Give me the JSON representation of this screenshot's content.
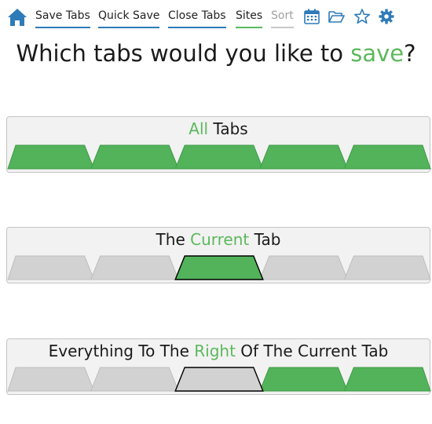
{
  "nav": {
    "home_icon": "home-icon",
    "links": [
      {
        "label": "Save Tabs",
        "state": "active"
      },
      {
        "label": "Quick Save",
        "state": "active"
      },
      {
        "label": "Close Tabs",
        "state": "active"
      },
      {
        "label": "Sites",
        "state": "highlight"
      },
      {
        "label": "Sort",
        "state": "disabled"
      }
    ],
    "icons": [
      "calendar-icon",
      "folder-open-icon",
      "star-icon",
      "gear-icon"
    ]
  },
  "heading": {
    "before": "Which tabs would you like to ",
    "accent": "save",
    "after": "?"
  },
  "options": [
    {
      "title_before": "",
      "title_accent": "All",
      "title_after": " Tabs",
      "tabs": [
        "selected",
        "selected",
        "selected",
        "selected",
        "selected"
      ],
      "current_index": null
    },
    {
      "title_before": "The ",
      "title_accent": "Current",
      "title_after": " Tab",
      "tabs": [
        "unselected",
        "unselected",
        "selected",
        "unselected",
        "unselected"
      ],
      "current_index": 2
    },
    {
      "title_before": "Everything To The ",
      "title_accent": "Right",
      "title_after": " Of The Current Tab",
      "tabs": [
        "unselected",
        "unselected",
        "unselected",
        "selected",
        "selected"
      ],
      "current_index": 2
    }
  ],
  "colors": {
    "accent_green": "#5cb85c",
    "tab_green": "#52b35a",
    "tab_grey": "#d2d2d2",
    "tab_grey_edge": "#bdbdbd",
    "link_blue": "#2e7bb8",
    "icon_blue": "#2e7bb8",
    "card_bg": "#f2f2f2"
  }
}
